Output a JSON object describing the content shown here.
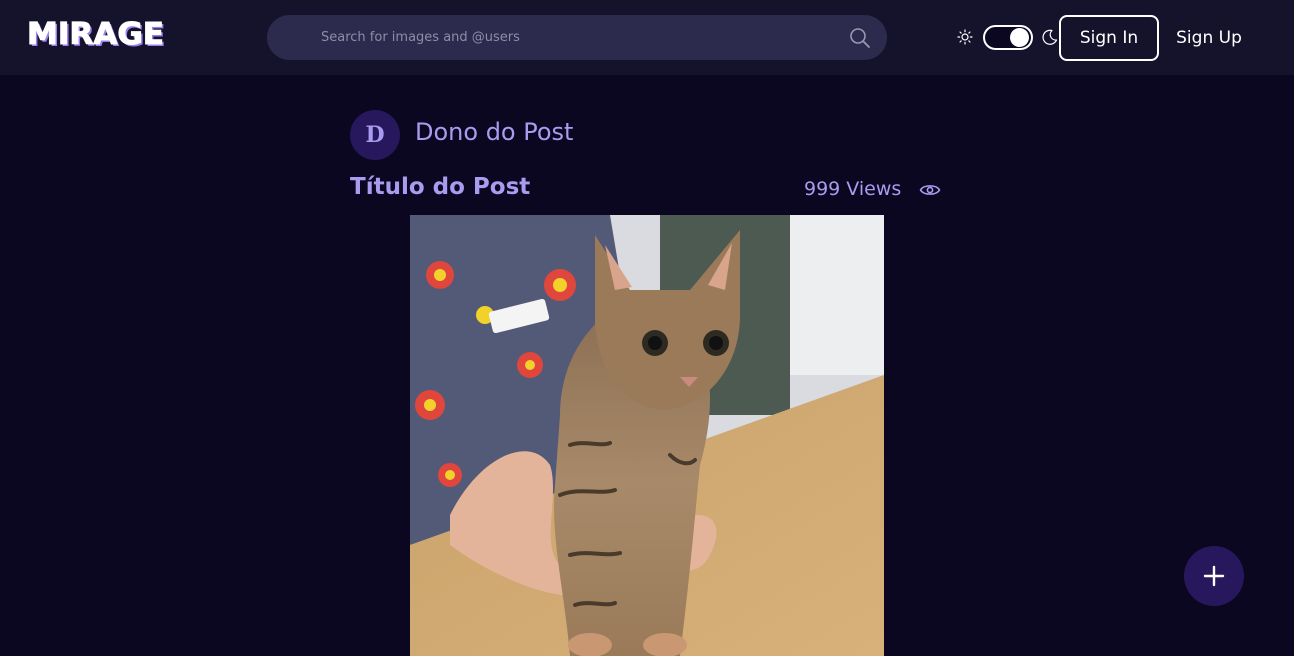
{
  "header": {
    "logo_text": "MIRAGE",
    "search_placeholder": "Search for images and @users",
    "theme_toggle": "dark",
    "signin_label": "Sign In",
    "signup_label": "Sign Up"
  },
  "post": {
    "owner_initial": "D",
    "owner_name": "Dono do Post",
    "title": "Título do Post",
    "views": "999 Views"
  },
  "icons": {
    "search": "search-icon",
    "sun": "sun-icon",
    "moon": "moon-icon",
    "eye": "eye-icon",
    "add": "plus-icon"
  },
  "colors": {
    "background": "#0b0720",
    "header": "#15132c",
    "search_bg": "#2d2b4d",
    "accent_text": "#a99cf0",
    "avatar_bg": "#27185e",
    "fab_bg": "#27185e"
  }
}
